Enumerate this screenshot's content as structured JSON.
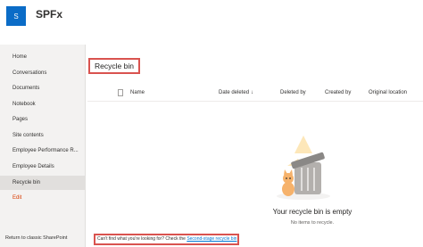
{
  "site": {
    "logo_letter": "S",
    "title": "SPFx"
  },
  "nav": {
    "items": [
      {
        "label": "Home",
        "name": "sidebar-item-home"
      },
      {
        "label": "Conversations",
        "name": "sidebar-item-conversations"
      },
      {
        "label": "Documents",
        "name": "sidebar-item-documents"
      },
      {
        "label": "Notebook",
        "name": "sidebar-item-notebook"
      },
      {
        "label": "Pages",
        "name": "sidebar-item-pages"
      },
      {
        "label": "Site contents",
        "name": "sidebar-item-site-contents"
      },
      {
        "label": "Employee Performance R...",
        "name": "sidebar-item-employee-performance"
      },
      {
        "label": "Employee Details",
        "name": "sidebar-item-employee-details"
      },
      {
        "label": "Recycle bin",
        "name": "sidebar-item-recycle-bin",
        "selected": true
      },
      {
        "label": "Edit",
        "name": "sidebar-item-edit",
        "edit": true
      }
    ],
    "classic_link": "Return to classic SharePoint"
  },
  "page": {
    "title": "Recycle bin"
  },
  "table": {
    "doc_icon": "document-icon",
    "columns": {
      "name": "Name",
      "date_deleted": "Date deleted",
      "sort_arrow": "↓",
      "deleted_by": "Deleted by",
      "created_by": "Created by",
      "original_location": "Original location"
    }
  },
  "empty_state": {
    "illustration_icon": "cat-in-bin-icon",
    "title": "Your recycle bin is empty",
    "subtitle": "No items to recycle."
  },
  "footer": {
    "prefix": "Can't find what you're looking for? Check the ",
    "link": "Second-stage recycle bin"
  },
  "colors": {
    "brand": "#0b6cc7",
    "highlight_border": "#d9534f",
    "link": "#0078d4",
    "edit": "#d83b01"
  }
}
